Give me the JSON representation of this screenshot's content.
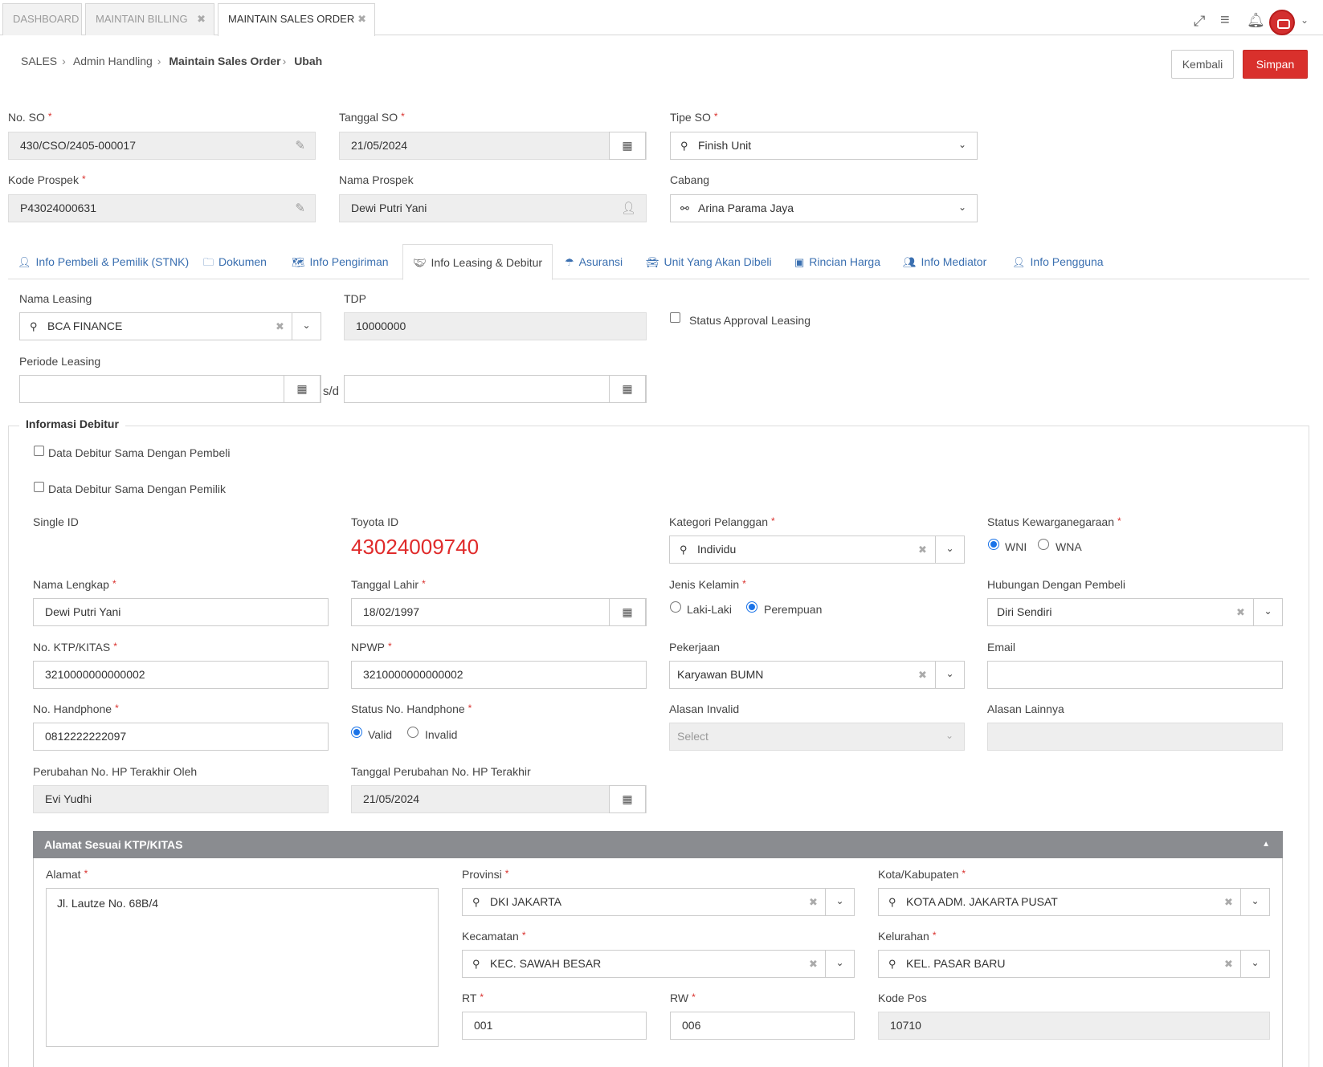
{
  "top_tabs": [
    {
      "label": "DASHBOARD",
      "closable": false
    },
    {
      "label": "MAINTAIN BILLING",
      "closable": true
    },
    {
      "label": "MAINTAIN SALES ORDER",
      "closable": true,
      "active": true
    }
  ],
  "breadcrumb": [
    "SALES",
    "Admin Handling",
    "Maintain Sales Order",
    "Ubah"
  ],
  "actions": {
    "back": "Kembali",
    "save": "Simpan"
  },
  "header_form": {
    "no_so": {
      "label": "No. SO",
      "value": "430/CSO/2405-000017"
    },
    "tanggal_so": {
      "label": "Tanggal SO",
      "value": "21/05/2024"
    },
    "tipe_so": {
      "label": "Tipe SO",
      "value": "Finish Unit"
    },
    "kode_prospek": {
      "label": "Kode Prospek",
      "value": "P43024000631"
    },
    "nama_prospek": {
      "label": "Nama Prospek",
      "value": "Dewi Putri Yani"
    },
    "cabang": {
      "label": "Cabang",
      "value": "Arina Parama Jaya"
    }
  },
  "form_tabs": [
    {
      "label": "Info Pembeli & Pemilik (STNK)",
      "icon": "user-icon"
    },
    {
      "label": "Dokumen",
      "icon": "folder-icon"
    },
    {
      "label": "Info Pengiriman",
      "icon": "map-icon"
    },
    {
      "label": "Info Leasing & Debitur",
      "icon": "handshake-icon",
      "active": true
    },
    {
      "label": "Asuransi",
      "icon": "umbrella-icon"
    },
    {
      "label": "Unit Yang Akan Dibeli",
      "icon": "car-icon"
    },
    {
      "label": "Rincian Harga",
      "icon": "money-icon"
    },
    {
      "label": "Info Mediator",
      "icon": "users-icon"
    },
    {
      "label": "Info Pengguna",
      "icon": "user-icon"
    }
  ],
  "leasing": {
    "nama_leasing": {
      "label": "Nama Leasing",
      "value": "BCA FINANCE"
    },
    "tdp": {
      "label": "TDP",
      "value": "10000000"
    },
    "status_approval": {
      "label": "Status Approval Leasing",
      "checked": false
    },
    "periode": {
      "label": "Periode Leasing",
      "from": "",
      "to": "",
      "separator": "s/d"
    }
  },
  "debitur": {
    "legend": "Informasi Debitur",
    "same_as_buyer": "Data Debitur Sama Dengan Pembeli",
    "same_as_owner": "Data Debitur Sama Dengan Pemilik",
    "single_id": {
      "label": "Single ID",
      "value": ""
    },
    "toyota_id": {
      "label": "Toyota ID",
      "value": "43024009740"
    },
    "kategori": {
      "label": "Kategori Pelanggan",
      "value": "Individu"
    },
    "kewarganegaraan": {
      "label": "Status Kewarganegaraan",
      "options": [
        "WNI",
        "WNA"
      ],
      "selected": "WNI"
    },
    "nama_lengkap": {
      "label": "Nama Lengkap",
      "value": "Dewi Putri Yani"
    },
    "tanggal_lahir": {
      "label": "Tanggal Lahir",
      "value": "18/02/1997"
    },
    "jenis_kelamin": {
      "label": "Jenis Kelamin",
      "options": [
        "Laki-Laki",
        "Perempuan"
      ],
      "selected": "Perempuan"
    },
    "hubungan": {
      "label": "Hubungan Dengan Pembeli",
      "value": "Diri Sendiri"
    },
    "ktp": {
      "label": "No. KTP/KITAS",
      "value": "3210000000000002"
    },
    "npwp": {
      "label": "NPWP",
      "value": "3210000000000002"
    },
    "pekerjaan": {
      "label": "Pekerjaan",
      "value": "Karyawan BUMN"
    },
    "email": {
      "label": "Email",
      "value": ""
    },
    "handphone": {
      "label": "No. Handphone",
      "value": "0812222222097"
    },
    "status_hp": {
      "label": "Status No. Handphone",
      "options": [
        "Valid",
        "Invalid"
      ],
      "selected": "Valid"
    },
    "alasan_invalid": {
      "label": "Alasan Invalid",
      "placeholder": "Select"
    },
    "alasan_lainnya": {
      "label": "Alasan Lainnya",
      "value": ""
    },
    "perubahan_oleh": {
      "label": "Perubahan No. HP Terakhir Oleh",
      "value": "Evi Yudhi"
    },
    "tanggal_perubahan": {
      "label": "Tanggal Perubahan No. HP Terakhir",
      "value": "21/05/2024"
    }
  },
  "alamat": {
    "title": "Alamat Sesuai KTP/KITAS",
    "alamat": {
      "label": "Alamat",
      "value": "Jl. Lautze No. 68B/4"
    },
    "provinsi": {
      "label": "Provinsi",
      "value": "DKI JAKARTA"
    },
    "kota": {
      "label": "Kota/Kabupaten",
      "value": "KOTA ADM. JAKARTA PUSAT"
    },
    "kecamatan": {
      "label": "Kecamatan",
      "value": "KEC. SAWAH BESAR"
    },
    "kelurahan": {
      "label": "Kelurahan",
      "value": "KEL. PASAR BARU"
    },
    "rt": {
      "label": "RT",
      "value": "001"
    },
    "rw": {
      "label": "RW",
      "value": "006"
    },
    "kode_pos": {
      "label": "Kode Pos",
      "value": "10710"
    }
  },
  "colors": {
    "primary": "#d9302c",
    "link": "#3a6fb0",
    "toyota_id": "#e02b2b",
    "panel_header": "#8a8c90"
  }
}
